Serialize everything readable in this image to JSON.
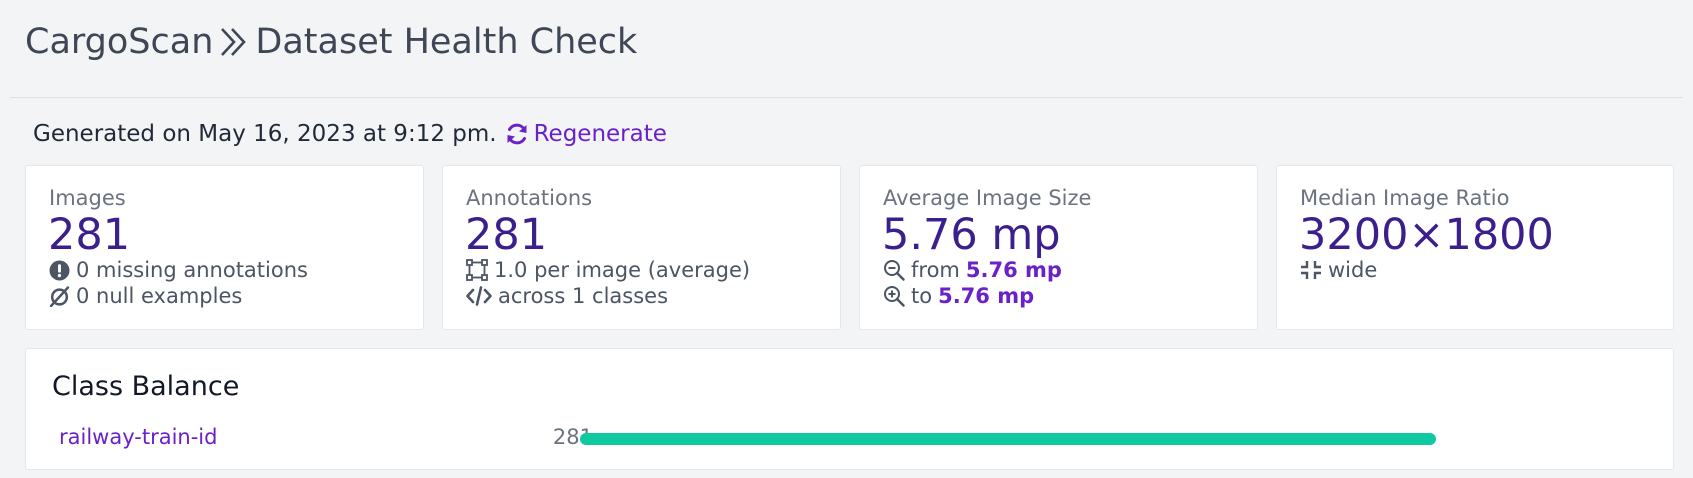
{
  "header": {
    "project": "CargoScan",
    "page_title": "Dataset Health Check"
  },
  "generated": {
    "text": "Generated on May 16, 2023 at 9:12 pm.",
    "regenerate_label": "Regenerate"
  },
  "cards": {
    "images": {
      "label": "Images",
      "value": "281",
      "missing": "0 missing annotations",
      "null": "0 null examples"
    },
    "annotations": {
      "label": "Annotations",
      "value": "281",
      "per_image": "1.0 per image (average)",
      "classes": "across 1 classes"
    },
    "avg_size": {
      "label": "Average Image Size",
      "value": "5.76 mp",
      "from_label": "from",
      "from_value": "5.76 mp",
      "to_label": "to",
      "to_value": "5.76 mp"
    },
    "median_ratio": {
      "label": "Median Image Ratio",
      "value": "3200×1800",
      "shape": "wide"
    }
  },
  "class_balance": {
    "title": "Class Balance",
    "classes": [
      {
        "name": "railway-train-id",
        "count": "281",
        "fraction": 1.0
      }
    ]
  },
  "colors": {
    "accent": "#6b21c8",
    "value": "#3b1f8c",
    "bar": "#10c9a1"
  }
}
